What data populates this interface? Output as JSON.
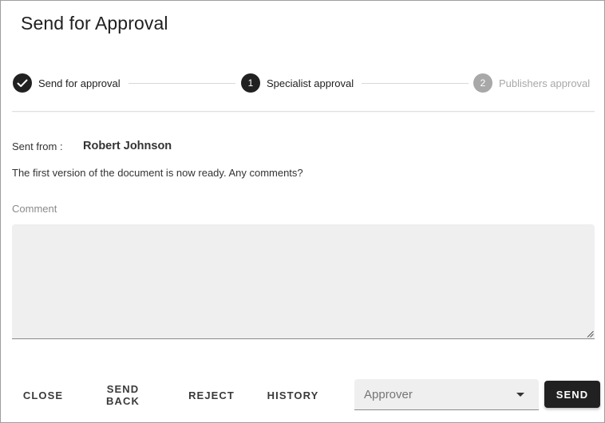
{
  "dialog": {
    "title": "Send for Approval"
  },
  "stepper": {
    "steps": [
      {
        "label": "Send for approval",
        "state": "done",
        "icon": "check-icon"
      },
      {
        "label": "Specialist approval",
        "state": "active",
        "number": "1"
      },
      {
        "label": "Publishers approval",
        "state": "pending",
        "number": "2"
      }
    ]
  },
  "details": {
    "sent_from_label": "Sent from :",
    "sent_from_name": "Robert Johnson",
    "message": "The first version of the document is now ready. Any comments?",
    "comment_label": "Comment",
    "comment_value": ""
  },
  "actions": {
    "close_label": "CLOSE",
    "send_back_label": "SEND BACK",
    "reject_label": "REJECT",
    "history_label": "HISTORY",
    "approver_placeholder": "Approver",
    "send_label": "SEND"
  },
  "colors": {
    "primary": "#212121",
    "pending": "#a8a8a8",
    "field_background": "#efefef"
  }
}
